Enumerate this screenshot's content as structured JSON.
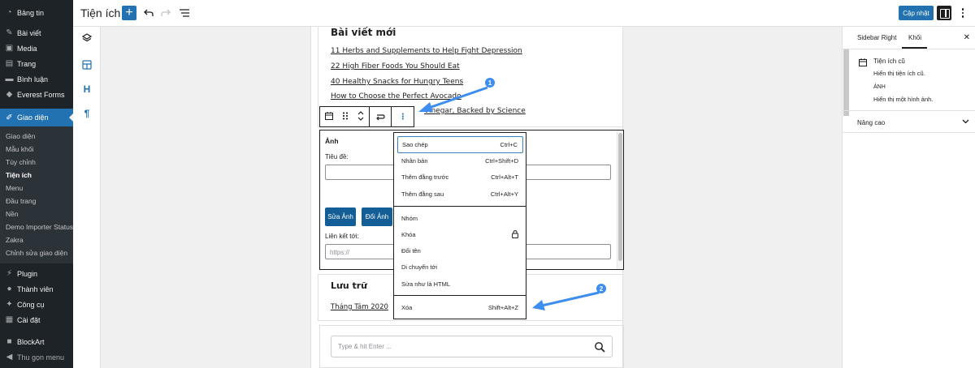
{
  "admin_menu": {
    "top_items": [
      "Bảng tin",
      "Bài viết",
      "Media",
      "Trang",
      "Bình luận",
      "Everest Forms"
    ],
    "active": "Giao diện",
    "submenu": [
      "Giao diện",
      "Mẫu khối",
      "Tùy chỉnh",
      "Tiện ích",
      "Menu",
      "Đầu trang",
      "Nền",
      "Demo Importer Status",
      "Zakra",
      "Chỉnh sửa giao diện"
    ],
    "current_sub": "Tiện ích",
    "bottom_items": [
      "Plugin",
      "Thành viên",
      "Công cụ",
      "Cài đặt"
    ],
    "extra_items": [
      "BlockArt",
      "Thu gọn menu"
    ]
  },
  "topbar": {
    "title": "Tiện ích",
    "add_icon": "+",
    "update_label": "Cập nhật"
  },
  "recent_posts": {
    "title": "Bài viết mới",
    "links": [
      "11 Herbs and Supplements to Help Fight Depression",
      "22 High Fiber Foods You Should Eat",
      "40 Healthy Snacks for Hungry Teens",
      "How to Choose the Perfect Avocado",
      "Vinegar, Backed by Science"
    ]
  },
  "image_widget": {
    "title": "Ảnh",
    "title_label": "Tiêu đề:",
    "edit_button": "Sửa Ảnh",
    "change_button": "Đổi Ảnh",
    "link_label": "Liên kết tới:",
    "url_placeholder": "https://"
  },
  "archive": {
    "title": "Lưu trữ",
    "link": "Tháng Tám 2020"
  },
  "search": {
    "placeholder": "Type & hit Enter ..."
  },
  "context_menu": {
    "group1": [
      {
        "label": "Sao chép",
        "shortcut": "Ctrl+C"
      },
      {
        "label": "Nhân bản",
        "shortcut": "Ctrl+Shift+D"
      },
      {
        "label": "Thêm đằng trước",
        "shortcut": "Ctrl+Alt+T"
      },
      {
        "label": "Thêm đằng sau",
        "shortcut": "Ctrl+Alt+Y"
      }
    ],
    "group2": [
      "Nhóm",
      "Khóa",
      "Đổi tên",
      "Di chuyển tới",
      "Sửa như là HTML"
    ],
    "group3": [
      {
        "label": "Xóa",
        "shortcut": "Shift+Alt+Z"
      }
    ]
  },
  "annotations": [
    "1",
    "2"
  ],
  "settings": {
    "tab_sidebar": "Sidebar Right",
    "tab_block": "Khối",
    "block_title": "Tiện ích cũ",
    "block_desc": "Hiển thị tiện ích cũ.",
    "variant_title": "ẢNH",
    "variant_desc": "Hiển thị một hình ảnh.",
    "advanced": "Nâng cao"
  },
  "colors": {
    "admin_bg": "#1d2327",
    "accent": "#2271b1",
    "annotation": "#3d8ef0"
  }
}
